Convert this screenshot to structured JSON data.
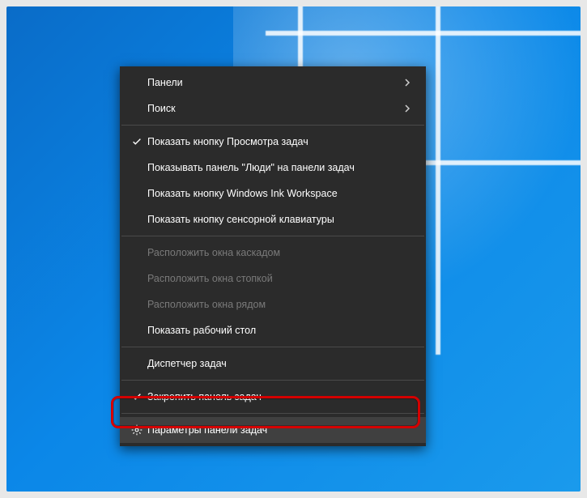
{
  "menu": {
    "groups": [
      [
        {
          "id": "panels",
          "label": "Панели",
          "submenu": true,
          "enabled": true
        },
        {
          "id": "search",
          "label": "Поиск",
          "submenu": true,
          "enabled": true
        }
      ],
      [
        {
          "id": "task-view",
          "label": "Показать кнопку Просмотра задач",
          "checked": true,
          "enabled": true
        },
        {
          "id": "people-bar",
          "label": "Показывать панель \"Люди\" на панели задач",
          "checked": false,
          "enabled": true
        },
        {
          "id": "ink-workspace",
          "label": "Показать кнопку Windows Ink Workspace",
          "checked": false,
          "enabled": true
        },
        {
          "id": "touch-keyboard",
          "label": "Показать кнопку сенсорной клавиатуры",
          "checked": false,
          "enabled": true
        }
      ],
      [
        {
          "id": "cascade",
          "label": "Расположить окна каскадом",
          "enabled": false
        },
        {
          "id": "stacked",
          "label": "Расположить окна стопкой",
          "enabled": false
        },
        {
          "id": "sidebyside",
          "label": "Расположить окна рядом",
          "enabled": false
        },
        {
          "id": "show-desktop",
          "label": "Показать рабочий стол",
          "enabled": true
        }
      ],
      [
        {
          "id": "task-manager",
          "label": "Диспетчер задач",
          "enabled": true
        }
      ],
      [
        {
          "id": "lock-taskbar",
          "label": "Закрепить панель задач",
          "checked": true,
          "enabled": true
        }
      ],
      [
        {
          "id": "taskbar-settings",
          "label": "Параметры панели задач",
          "icon": "gear",
          "enabled": true,
          "highlighted": true
        }
      ]
    ]
  }
}
